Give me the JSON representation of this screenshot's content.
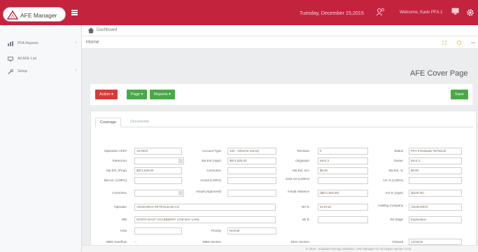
{
  "topbar": {
    "logo_text": "AFE Manager",
    "date": "Tuesday, December 15,2015",
    "welcome": "Welcome, Kadv PFA 1"
  },
  "sidebar": {
    "items": [
      {
        "label": "PFA Reports",
        "chevron": "›"
      },
      {
        "label": "All AFE List",
        "chevron": ""
      },
      {
        "label": "Setup",
        "chevron": "›"
      }
    ]
  },
  "breadcrumb": {
    "label": "Dashboard"
  },
  "home": {
    "label": "Home"
  },
  "page": {
    "title": "AFE Cover Page"
  },
  "toolbar": {
    "action": "Action ▾",
    "page": "Page ▾",
    "reports": "Reports ▾",
    "save": "Save"
  },
  "tabs": {
    "coverage": "Coverage",
    "documents": "Documents"
  },
  "form": {
    "operation_afe_label": "Operation AFE#",
    "operation_afe": "15-0002",
    "account_type_label": "Account Type",
    "account_type": "104 - Airborne Survey",
    "revision_label": "Revision",
    "revision": "0",
    "status_label": "Status",
    "status": "PFA-0 Evaluate Technical",
    "parent_no_label": "Parent No",
    "parent_no": "",
    "ma_est_appr_label": "Ma Est (Appr)",
    "ma_est_appr": "$871,825.00",
    "originator_label": "Originator",
    "originator": "MAS 2",
    "owner_label": "Owner",
    "owner": "MAS 2",
    "ma_est_prop_label": "Ma Est. (Prop)",
    "ma_est_prop": "$871,825.00",
    "correction_label": "Correction",
    "correction": "",
    "ma_est_incr_label": "Ma Est. Incr",
    "ma_est_incr": "$0.00",
    "ma_est_pct_label": "Ma Est. %",
    "ma_est_pct": "$0.00",
    "ma_act_label": "Ma Act. (LOE%)",
    "ma_act": "",
    "actual_label": "Actual (LOE%)",
    "actual": "",
    "joint_act_label": "Joint Act (LOE%)",
    "joint_act": "",
    "act_pct_label": "Act % (LOE%)",
    "act_pct": "",
    "correction2_label": "Correction",
    "correction2": "",
    "actual_approved_label": "Actual (Approved)",
    "actual_approved": "",
    "actual_variance_label": "Actual Variance",
    "actual_variance": "($871,825.00)",
    "act_pct_appr_label": "Act % (Appr)",
    "act_pct_appr": "($100.00)",
    "operator_label": "Operator",
    "operator": "ANADARKO PETROLEUM CO",
    "wi_label": "WI %",
    "wi": "42.5718",
    "holding_company_label": "Holding Company",
    "holding_company": "ANADARKO",
    "wb_label": "WB",
    "wb": "NORTH EAST HACKBERRY LOW BAY LAKE",
    "wi_d_label": "WI D",
    "wi_d": "",
    "wi_stage_label": "WI Stage",
    "wi_stage": "Exploration",
    "area_label": "Area",
    "area": "",
    "priority_label": "Priority",
    "priority": "Normal",
    "wbs_overflow_label": "WBS Overflow",
    "wbs_overflow": "--",
    "wbs_section_label": "WBS Section",
    "wbs_section": "",
    "doc_section_label": "DOC Section",
    "doc_section": "",
    "cleared_label": "Cleared",
    "cleared": "12/15/15"
  },
  "footer": {
    "text": "© 2015 - Anadarko Energy Solutions. AFE Manager for Oil Organ Version 2.0.5"
  }
}
